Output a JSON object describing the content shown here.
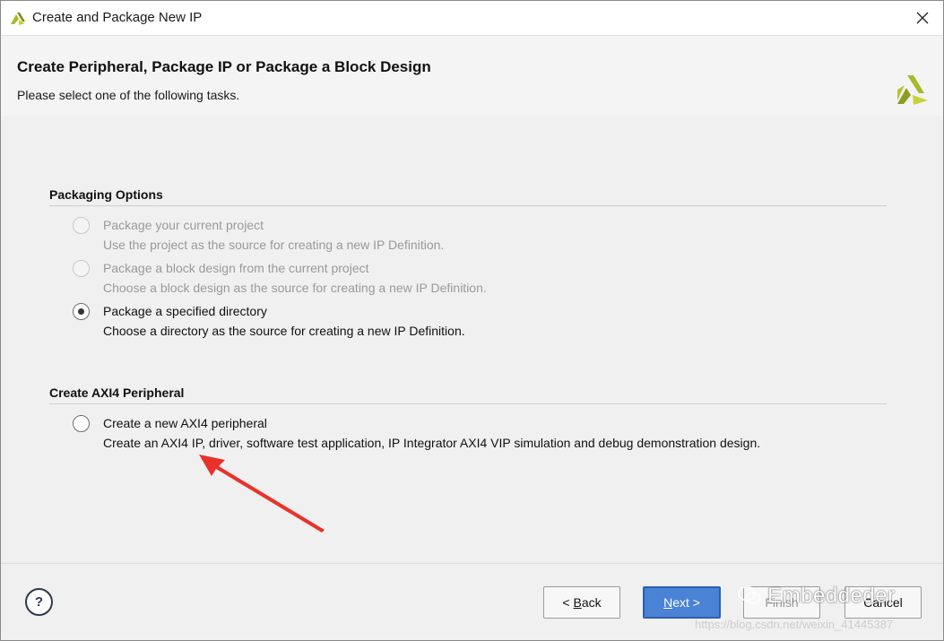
{
  "window": {
    "title": "Create and Package New IP"
  },
  "header": {
    "heading": "Create Peripheral, Package IP or Package a Block Design",
    "subheading": "Please select one of the following tasks."
  },
  "packaging": {
    "title": "Packaging Options",
    "options": [
      {
        "label": "Package your current project",
        "description": "Use the project as the source for creating a new IP Definition.",
        "enabled": false,
        "selected": false
      },
      {
        "label": "Package a block design from the current project",
        "description": "Choose a block design as the source for creating a new IP Definition.",
        "enabled": false,
        "selected": false
      },
      {
        "label": "Package a specified directory",
        "description": "Choose a directory as the source for creating a new IP Definition.",
        "enabled": true,
        "selected": true
      }
    ]
  },
  "axi": {
    "title": "Create AXI4 Peripheral",
    "options": [
      {
        "label": "Create a new AXI4 peripheral",
        "description": "Create an AXI4 IP, driver, software test application, IP Integrator AXI4 VIP simulation and debug demonstration design.",
        "enabled": true,
        "selected": false
      }
    ]
  },
  "footer": {
    "help": "?",
    "back_prefix": "< ",
    "back_key": "B",
    "back_rest": "ack",
    "next_key": "N",
    "next_rest": "ext >",
    "finish": "Finish",
    "cancel": "Cancel"
  },
  "watermark": {
    "brand": "Embeddeder",
    "url": "https://blog.csdn.net/weixin_41445387"
  },
  "colors": {
    "accent": "#4a82d6",
    "arrow": "#e8322a",
    "logo": "#a9b82a"
  }
}
